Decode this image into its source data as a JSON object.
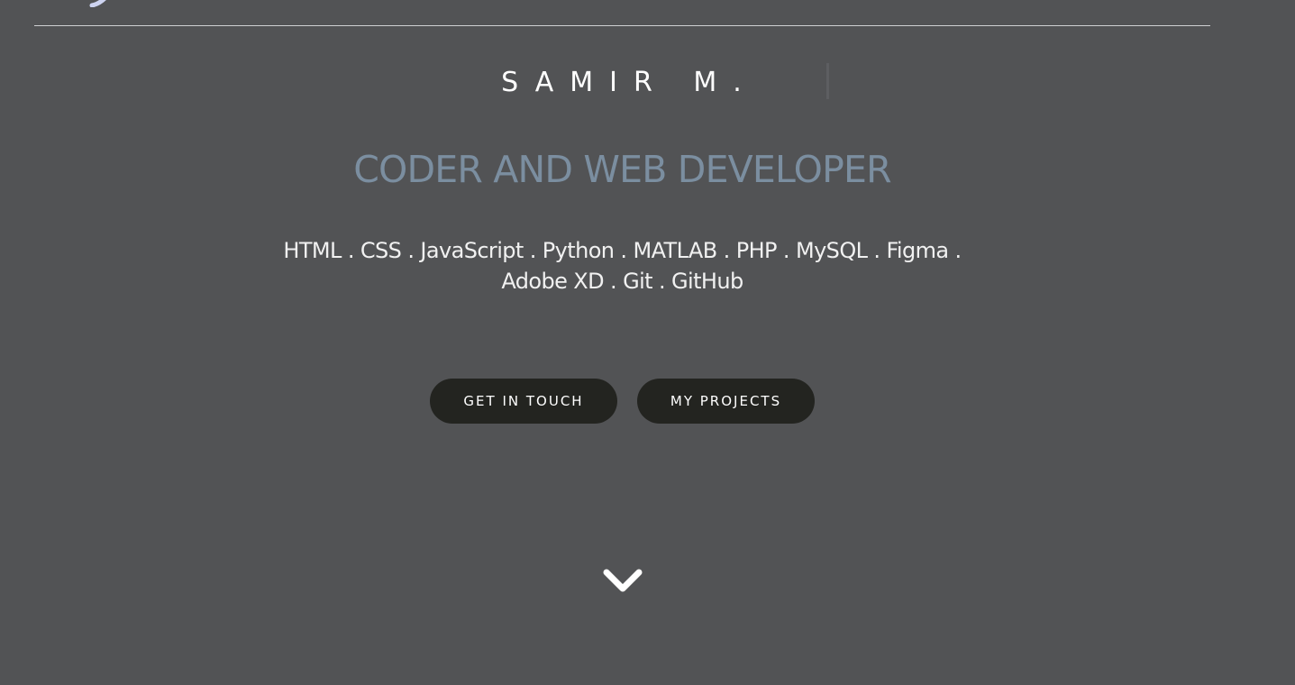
{
  "hero": {
    "name": "SAMIR M.",
    "role": "CODER AND WEB DEVELOPER",
    "skills_line_1": "HTML . CSS . JavaScript . Python . MATLAB . PHP . MySQL . Figma .",
    "skills_line_2": "Adobe XD . Git . GitHub"
  },
  "actions": {
    "get_in_touch_label": "GET IN TOUCH",
    "my_projects_label": "MY PROJECTS"
  },
  "icons": {
    "scroll": "chevron-down-icon",
    "logo": "logo-icon"
  },
  "colors": {
    "background": "#525355",
    "accent_title": "#7b8ea0",
    "button_bg": "#232420",
    "text": "#f2f2f2"
  }
}
